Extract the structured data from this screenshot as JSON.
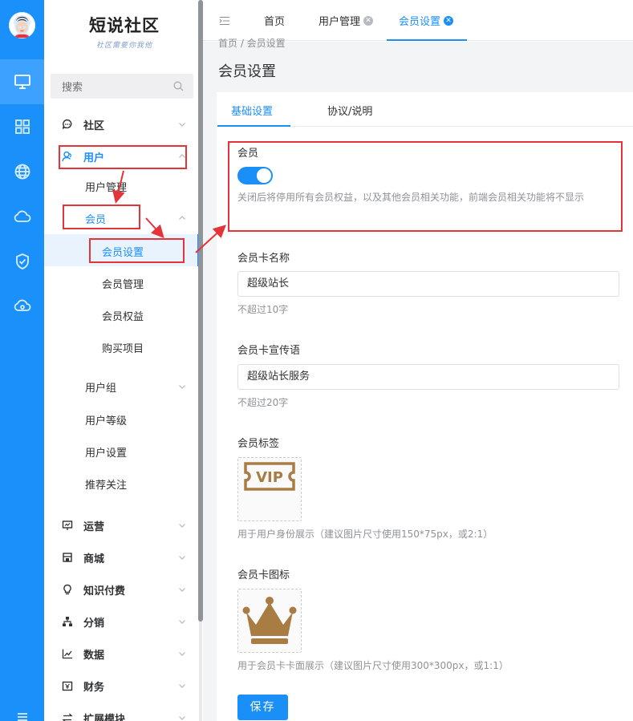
{
  "brand": {
    "logo_title": "短说社区",
    "logo_subtitle": "社区需要你我他"
  },
  "rail": {
    "items": [
      "monitor-icon",
      "grid-icon",
      "globe-icon",
      "cloud-icon",
      "shield-icon",
      "cloud-settings-icon"
    ]
  },
  "search": {
    "placeholder": "搜索"
  },
  "sidebar": {
    "community": "社区",
    "user": "用户",
    "user_manage": "用户管理",
    "member": "会员",
    "member_settings": "会员设置",
    "member_manage": "会员管理",
    "member_rights": "会员权益",
    "purchase_items": "购买项目",
    "user_group": "用户组",
    "user_level": "用户等级",
    "user_settings": "用户设置",
    "recommend_follow": "推荐关注",
    "operation": "运营",
    "mall": "商城",
    "knowledge_pay": "知识付费",
    "distribution": "分销",
    "data": "数据",
    "finance": "财务",
    "extensions": "扩展模块"
  },
  "tabs": {
    "home": "首页",
    "user_manage": "用户管理",
    "member_settings": "会员设置"
  },
  "breadcrumb": {
    "text": "首页 / 会员设置"
  },
  "page": {
    "title": "会员设置",
    "subtabs": {
      "basic": "基础设置",
      "agreement": "协议/说明"
    }
  },
  "form": {
    "member_label": "会员",
    "member_enabled": true,
    "member_hint": "关闭后将停用所有会员权益，以及其他会员相关功能，前端会员相关功能将不显示",
    "card_name_label": "会员卡名称",
    "card_name_value": "超级站长",
    "card_name_hint": "不超过10字",
    "slogan_label": "会员卡宣传语",
    "slogan_value": "超级站长服务",
    "slogan_hint": "不超过20字",
    "tag_label": "会员标签",
    "tag_hint": "用于用户身份展示（建议图片尺寸使用150*75px，或2:1）",
    "icon_label": "会员卡图标",
    "icon_hint": "用于会员卡卡面展示（建议图片尺寸使用300*300px，或1:1）",
    "vip_text": "VIP",
    "save": "保存"
  },
  "colors": {
    "accent": "#1b8ff8",
    "rail": "#1990fa",
    "annotation": "#e5333a",
    "gold": "#a87c43"
  }
}
